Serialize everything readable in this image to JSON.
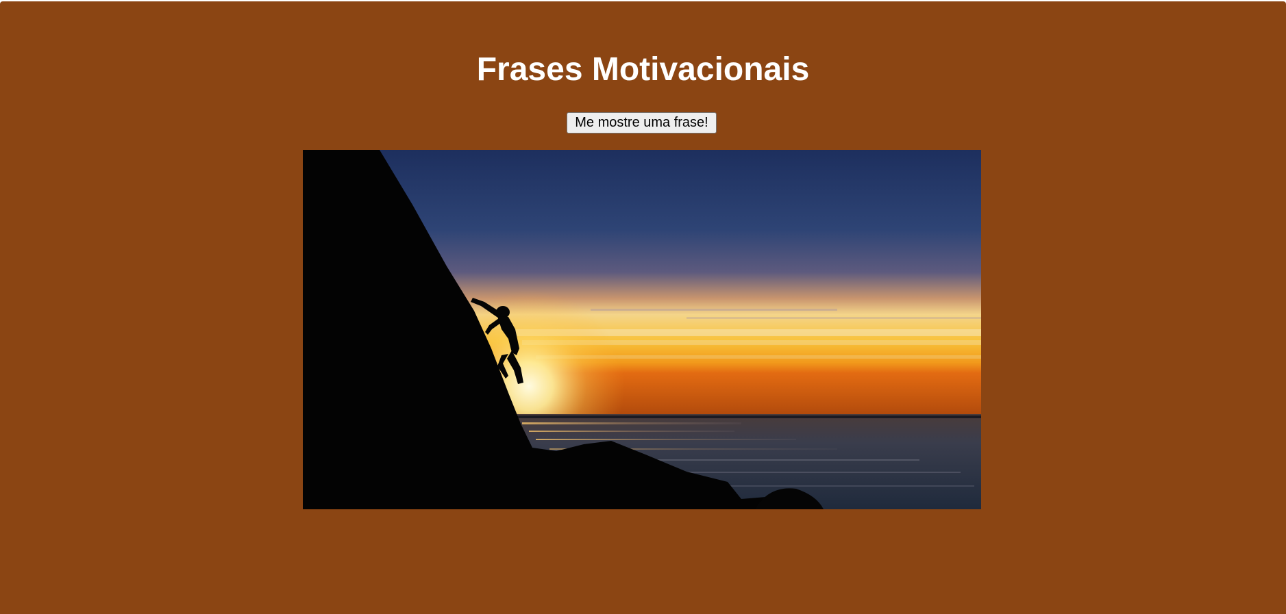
{
  "page": {
    "title": "Frases Motivacionais",
    "background_color": "#8B4513"
  },
  "actions": {
    "show_quote_label": "Me mostre uma frase!"
  },
  "image": {
    "alt": "",
    "subject": "climber silhouette on rock at sunset over the sea"
  }
}
